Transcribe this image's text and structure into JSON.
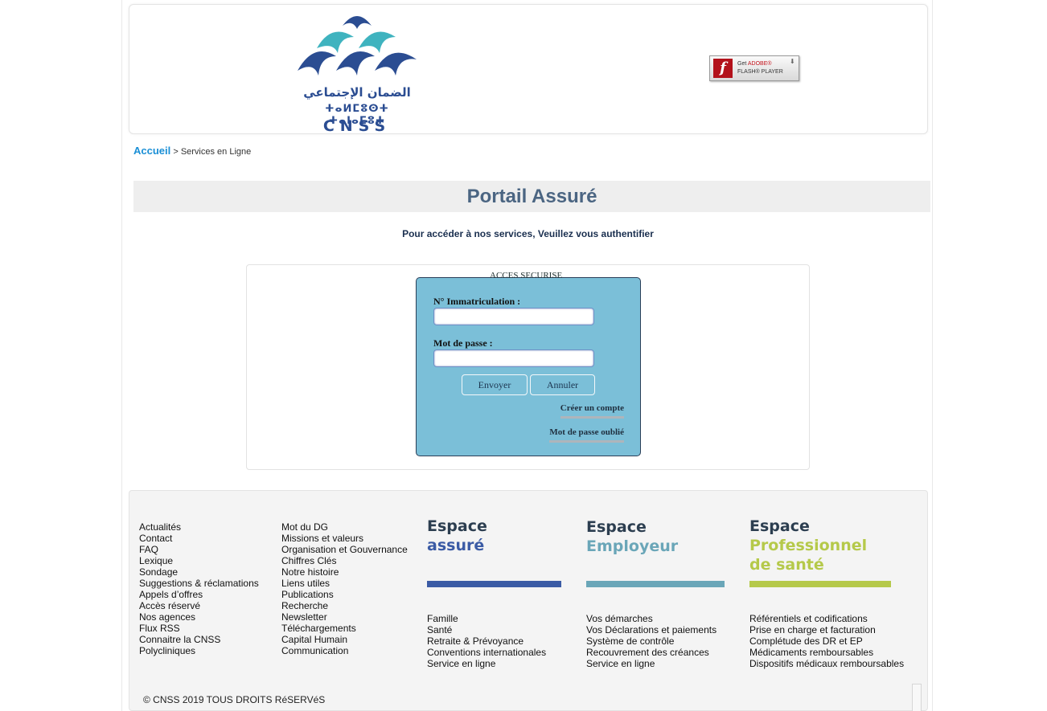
{
  "header": {
    "logo": {
      "arabic": "الضمان الإجتماعي",
      "tifinagh": "ⵜⴰⵍⵎⵓⵙⵜ ⵜⴰⵏⴰⵎⵓⵜ",
      "name": "CNSS",
      "colors": {
        "dark": "#2b4d92",
        "teal": "#3fb3bf"
      }
    },
    "flash_badge": {
      "line1_prefix": "Get",
      "line1_brand": "ADOBE®",
      "line2": "FLASH® PLAYER",
      "icon": "flash-icon"
    }
  },
  "breadcrumb": {
    "home": "Accueil",
    "separator": ">",
    "current": "Services en Ligne"
  },
  "page_title": "Portail Assuré",
  "subtitle": "Pour accéder à nos services, Veuillez vous authentifier",
  "login": {
    "legend": "ACCES SECURISE",
    "immatriculation_label": "N° Immatriculation :",
    "immatriculation_value": "",
    "password_label": "Mot de passe :",
    "password_value": "",
    "submit": "Envoyer",
    "cancel": "Annuler",
    "create_account": "Créer un compte",
    "forgot_password": "Mot de passe oublié"
  },
  "footer": {
    "col1": [
      "Actualités",
      "Contact",
      "FAQ",
      "Lexique",
      "Sondage",
      "Suggestions & réclamations",
      "Appels d’offres",
      "Accès réservé",
      "Nos agences",
      "Flux RSS",
      "Connaitre la CNSS",
      "Polycliniques"
    ],
    "col2": [
      "Mot du DG",
      "Missions et valeurs",
      "Organisation et Gouvernance",
      "Chiffres Clés",
      "Notre histoire",
      "Liens utiles",
      "Publications",
      "Recherche",
      "Newsletter",
      "Téléchargements",
      "Capital Humain",
      "Communication"
    ],
    "espace_assure": {
      "line1": "Espace",
      "line2": "assuré",
      "color": "#3b5ba5",
      "links": [
        "Famille",
        "Santé",
        "Retraite & Prévoyance",
        "Conventions internationales",
        "Service en ligne"
      ]
    },
    "espace_employeur": {
      "line1": "Espace",
      "line2": "Employeur",
      "color": "#6aa6b8",
      "links": [
        "Vos démarches",
        "Vos Déclarations et paiements",
        "Système de contrôle",
        "Recouvrement des créances",
        "Service en ligne"
      ]
    },
    "espace_sante": {
      "line1": "Espace",
      "line2": "Professionnel",
      "line3": "de santé",
      "color": "#b5c94a",
      "links": [
        "Référentiels et codifications",
        "Prise en charge et facturation",
        "Complétude des DR et EP",
        "Médicaments remboursables",
        "Dispositifs médicaux remboursables"
      ]
    },
    "copyright": "© CNSS 2019 TOUS DROITS RéSERVéS"
  }
}
